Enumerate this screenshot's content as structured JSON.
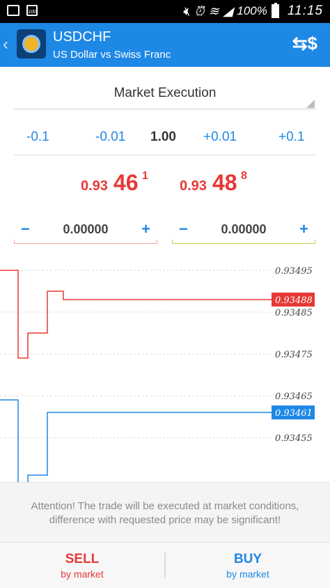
{
  "status_bar": {
    "battery": "100%",
    "time": "11:15",
    "icons": [
      "image-icon",
      "screenshot-icon",
      "mute-icon",
      "alarm-icon",
      "wifi-icon",
      "signal-icon",
      "battery-icon"
    ]
  },
  "header": {
    "symbol": "USDCHF",
    "description": "US Dollar vs Swiss Franc",
    "color": "#1E88E5"
  },
  "execution": {
    "label": "Market Execution"
  },
  "volume": {
    "steps": [
      "-0.1",
      "-0.01",
      "1.00",
      "+0.01",
      "+0.1"
    ]
  },
  "prices": {
    "sell": {
      "small": "0.93",
      "big": "46",
      "pip": "1"
    },
    "buy": {
      "small": "0.93",
      "big": "48",
      "pip": "8"
    },
    "color": "#e53935"
  },
  "stop_loss": {
    "minus": "−",
    "value": "0.00000",
    "plus": "+",
    "color": "#f5a3a3"
  },
  "take_profit": {
    "minus": "−",
    "value": "0.00000",
    "plus": "+",
    "color": "#c8c84a"
  },
  "chart_data": {
    "type": "line",
    "y_ticks": [
      "0.93495",
      "0.93485",
      "0.93475",
      "0.93465",
      "0.93455"
    ],
    "series": [
      {
        "color": "#e53935",
        "values": [
          0.93495,
          0.93495,
          0.93474,
          0.93474,
          0.9348,
          0.9348,
          0.9349,
          0.9349,
          0.93488,
          0.93488
        ],
        "last_label": "0.93488"
      },
      {
        "color": "#1E88E5",
        "values": [
          0.93464,
          0.93464,
          0.93444,
          0.93444,
          0.93446,
          0.93446,
          0.93461,
          0.93461
        ],
        "last_label": "0.93461"
      }
    ]
  },
  "attention": "Attention! The trade will be executed at market conditions, difference with requested price may be significant!",
  "buttons": {
    "sell": {
      "label": "SELL",
      "sub": "by market",
      "color": "#e53935"
    },
    "buy": {
      "label": "BUY",
      "sub": "by market",
      "color": "#1E88E5"
    }
  }
}
